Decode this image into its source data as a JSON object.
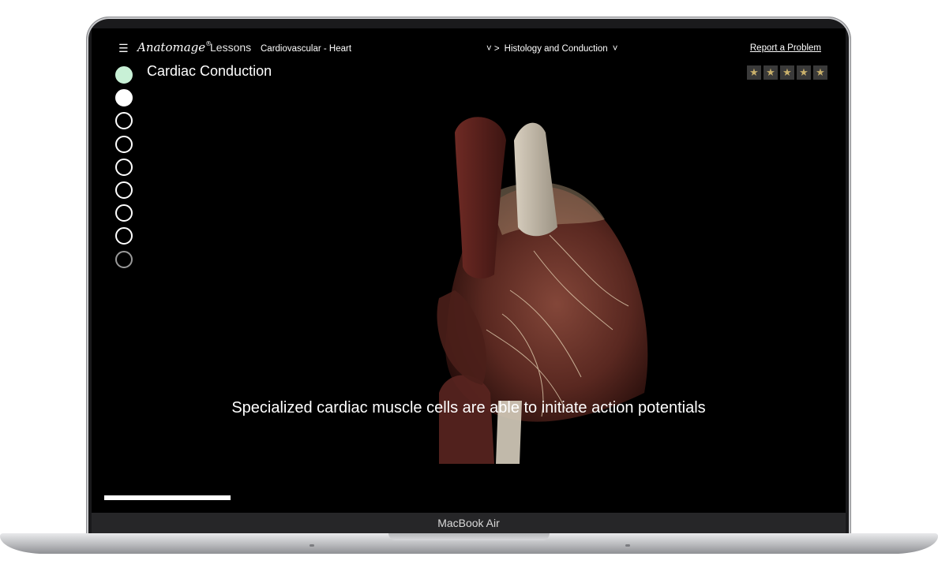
{
  "device": {
    "label": "MacBook Air"
  },
  "topbar": {
    "menu_icon": "hamburger-icon",
    "logo": "Anatomage",
    "logo_tm": "®",
    "logo_sub": "Lessons",
    "course": "Cardiovascular - Heart",
    "chapter_prefix": "˅  >",
    "chapter": "Histology and Conduction",
    "chapter_chevron": "˅",
    "report": "Report a Problem"
  },
  "lesson": {
    "title": "Cardiac Conduction",
    "steps": [
      {
        "state": "done"
      },
      {
        "state": "current"
      },
      {
        "state": "todo"
      },
      {
        "state": "todo"
      },
      {
        "state": "todo"
      },
      {
        "state": "todo"
      },
      {
        "state": "todo"
      },
      {
        "state": "todo"
      },
      {
        "state": "dim"
      }
    ],
    "rating": {
      "stars": 5,
      "icon": "star-icon",
      "glyph": "★"
    },
    "caption": "Specialized cardiac muscle cells are able to initiate action potentials",
    "progress": 1.0
  },
  "colors": {
    "screen_bg": "#000000",
    "step_done": "#c8f0d6",
    "star": "#c9b06b"
  }
}
